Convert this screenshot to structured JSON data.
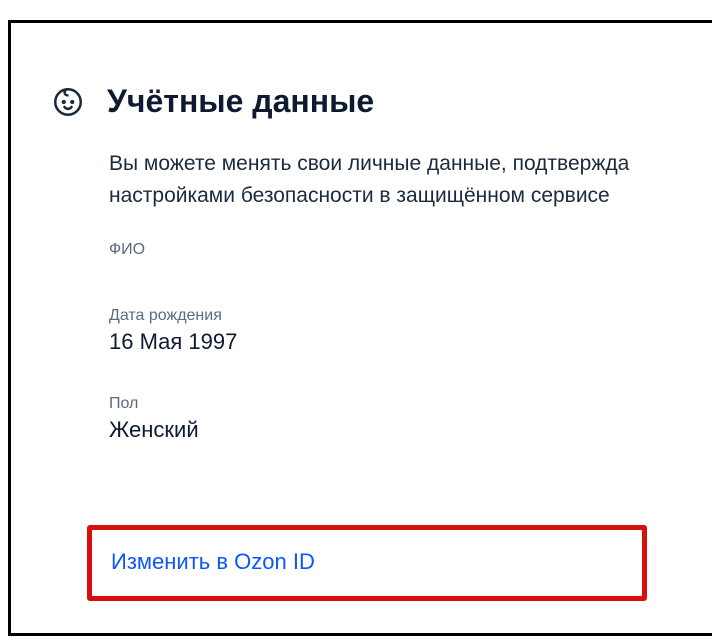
{
  "section": {
    "title": "Учётные данные",
    "description": "Вы можете менять свои личные данные, подтвержда\nнастройками безопасности в защищённом сервисе"
  },
  "fields": {
    "fio": {
      "label": "ФИО",
      "value": ""
    },
    "dob": {
      "label": "Дата рождения",
      "value": "16 Мая 1997"
    },
    "gender": {
      "label": "Пол",
      "value": "Женский"
    }
  },
  "link": {
    "label": "Изменить в Ozon ID"
  },
  "colors": {
    "link": "#0b56ff",
    "highlight": "#d80f0c",
    "text": "#1b2a3f",
    "muted": "#5a6a80"
  }
}
